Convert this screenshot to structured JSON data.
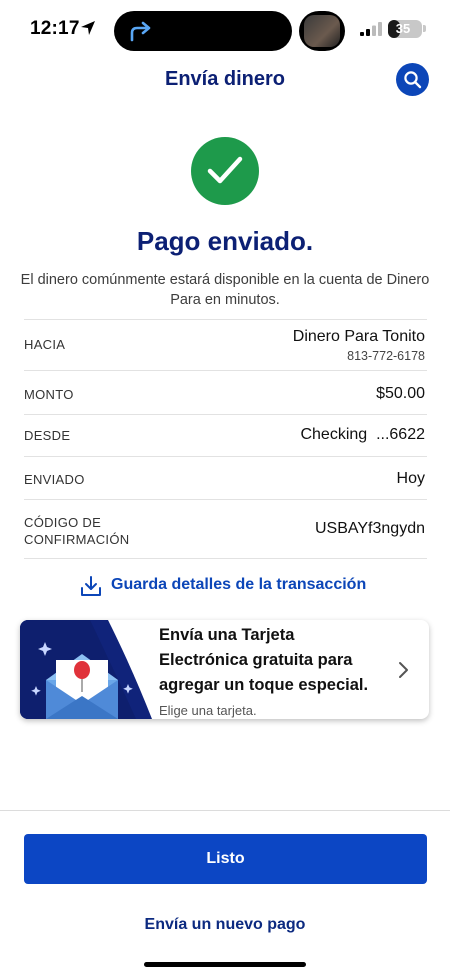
{
  "status_bar": {
    "time": "12:17",
    "battery_level": "35",
    "battery_fraction": 0.35
  },
  "header": {
    "title": "Envía dinero"
  },
  "success": {
    "title": "Pago enviado.",
    "subtitle": "El dinero comúnmente estará disponible en la cuenta de Dinero Para en minutos."
  },
  "details": {
    "to": {
      "label": "HACIA",
      "name": "Dinero Para Tonito",
      "phone": "813-772-6178"
    },
    "amount": {
      "label": "MONTO",
      "value": "$50.00"
    },
    "from": {
      "label": "DESDE",
      "account": "Checking",
      "mask": "...6622"
    },
    "sent": {
      "label": "ENVIADO",
      "value": "Hoy"
    },
    "confirmation": {
      "label_line1": "CÓDIGO DE",
      "label_line2": "CONFIRMACIÓN",
      "value": "USBAYf3ngydn"
    }
  },
  "save_link": {
    "label": "Guarda detalles de la transacción"
  },
  "promo": {
    "line1": "Envía una Tarjeta",
    "line2": "Electrónica gratuita para",
    "line3": "agregar un toque especial.",
    "sub": "Elige una tarjeta."
  },
  "actions": {
    "primary_label": "Listo",
    "secondary_label": "Envía un nuevo pago"
  },
  "colors": {
    "brand_navy": "#0c2074",
    "brand_blue": "#0c46c4",
    "success_green": "#1e9a4b"
  },
  "icons": {
    "location": "location-arrow-icon",
    "island_activity": "forward-arrow-icon",
    "search": "search-icon",
    "check": "checkmark-icon",
    "download": "download-icon",
    "chevron": "chevron-right-icon",
    "envelope": "envelope-balloon-icon"
  }
}
